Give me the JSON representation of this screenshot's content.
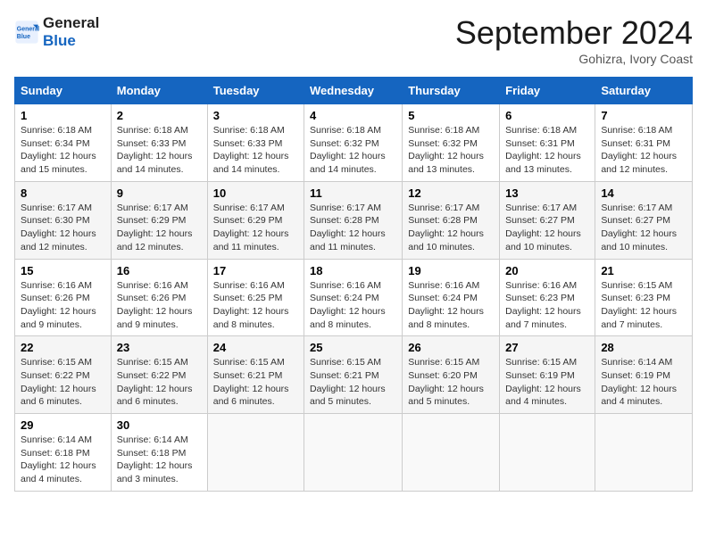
{
  "header": {
    "logo_line1": "General",
    "logo_line2": "Blue",
    "month_title": "September 2024",
    "location": "Gohizra, Ivory Coast"
  },
  "days_of_week": [
    "Sunday",
    "Monday",
    "Tuesday",
    "Wednesday",
    "Thursday",
    "Friday",
    "Saturday"
  ],
  "weeks": [
    [
      {
        "day": "1",
        "sunrise": "6:18 AM",
        "sunset": "6:34 PM",
        "daylight": "12 hours and 15 minutes."
      },
      {
        "day": "2",
        "sunrise": "6:18 AM",
        "sunset": "6:33 PM",
        "daylight": "12 hours and 14 minutes."
      },
      {
        "day": "3",
        "sunrise": "6:18 AM",
        "sunset": "6:33 PM",
        "daylight": "12 hours and 14 minutes."
      },
      {
        "day": "4",
        "sunrise": "6:18 AM",
        "sunset": "6:32 PM",
        "daylight": "12 hours and 14 minutes."
      },
      {
        "day": "5",
        "sunrise": "6:18 AM",
        "sunset": "6:32 PM",
        "daylight": "12 hours and 13 minutes."
      },
      {
        "day": "6",
        "sunrise": "6:18 AM",
        "sunset": "6:31 PM",
        "daylight": "12 hours and 13 minutes."
      },
      {
        "day": "7",
        "sunrise": "6:18 AM",
        "sunset": "6:31 PM",
        "daylight": "12 hours and 12 minutes."
      }
    ],
    [
      {
        "day": "8",
        "sunrise": "6:17 AM",
        "sunset": "6:30 PM",
        "daylight": "12 hours and 12 minutes."
      },
      {
        "day": "9",
        "sunrise": "6:17 AM",
        "sunset": "6:29 PM",
        "daylight": "12 hours and 12 minutes."
      },
      {
        "day": "10",
        "sunrise": "6:17 AM",
        "sunset": "6:29 PM",
        "daylight": "12 hours and 11 minutes."
      },
      {
        "day": "11",
        "sunrise": "6:17 AM",
        "sunset": "6:28 PM",
        "daylight": "12 hours and 11 minutes."
      },
      {
        "day": "12",
        "sunrise": "6:17 AM",
        "sunset": "6:28 PM",
        "daylight": "12 hours and 10 minutes."
      },
      {
        "day": "13",
        "sunrise": "6:17 AM",
        "sunset": "6:27 PM",
        "daylight": "12 hours and 10 minutes."
      },
      {
        "day": "14",
        "sunrise": "6:17 AM",
        "sunset": "6:27 PM",
        "daylight": "12 hours and 10 minutes."
      }
    ],
    [
      {
        "day": "15",
        "sunrise": "6:16 AM",
        "sunset": "6:26 PM",
        "daylight": "12 hours and 9 minutes."
      },
      {
        "day": "16",
        "sunrise": "6:16 AM",
        "sunset": "6:26 PM",
        "daylight": "12 hours and 9 minutes."
      },
      {
        "day": "17",
        "sunrise": "6:16 AM",
        "sunset": "6:25 PM",
        "daylight": "12 hours and 8 minutes."
      },
      {
        "day": "18",
        "sunrise": "6:16 AM",
        "sunset": "6:24 PM",
        "daylight": "12 hours and 8 minutes."
      },
      {
        "day": "19",
        "sunrise": "6:16 AM",
        "sunset": "6:24 PM",
        "daylight": "12 hours and 8 minutes."
      },
      {
        "day": "20",
        "sunrise": "6:16 AM",
        "sunset": "6:23 PM",
        "daylight": "12 hours and 7 minutes."
      },
      {
        "day": "21",
        "sunrise": "6:15 AM",
        "sunset": "6:23 PM",
        "daylight": "12 hours and 7 minutes."
      }
    ],
    [
      {
        "day": "22",
        "sunrise": "6:15 AM",
        "sunset": "6:22 PM",
        "daylight": "12 hours and 6 minutes."
      },
      {
        "day": "23",
        "sunrise": "6:15 AM",
        "sunset": "6:22 PM",
        "daylight": "12 hours and 6 minutes."
      },
      {
        "day": "24",
        "sunrise": "6:15 AM",
        "sunset": "6:21 PM",
        "daylight": "12 hours and 6 minutes."
      },
      {
        "day": "25",
        "sunrise": "6:15 AM",
        "sunset": "6:21 PM",
        "daylight": "12 hours and 5 minutes."
      },
      {
        "day": "26",
        "sunrise": "6:15 AM",
        "sunset": "6:20 PM",
        "daylight": "12 hours and 5 minutes."
      },
      {
        "day": "27",
        "sunrise": "6:15 AM",
        "sunset": "6:19 PM",
        "daylight": "12 hours and 4 minutes."
      },
      {
        "day": "28",
        "sunrise": "6:14 AM",
        "sunset": "6:19 PM",
        "daylight": "12 hours and 4 minutes."
      }
    ],
    [
      {
        "day": "29",
        "sunrise": "6:14 AM",
        "sunset": "6:18 PM",
        "daylight": "12 hours and 4 minutes."
      },
      {
        "day": "30",
        "sunrise": "6:14 AM",
        "sunset": "6:18 PM",
        "daylight": "12 hours and 3 minutes."
      },
      null,
      null,
      null,
      null,
      null
    ]
  ]
}
